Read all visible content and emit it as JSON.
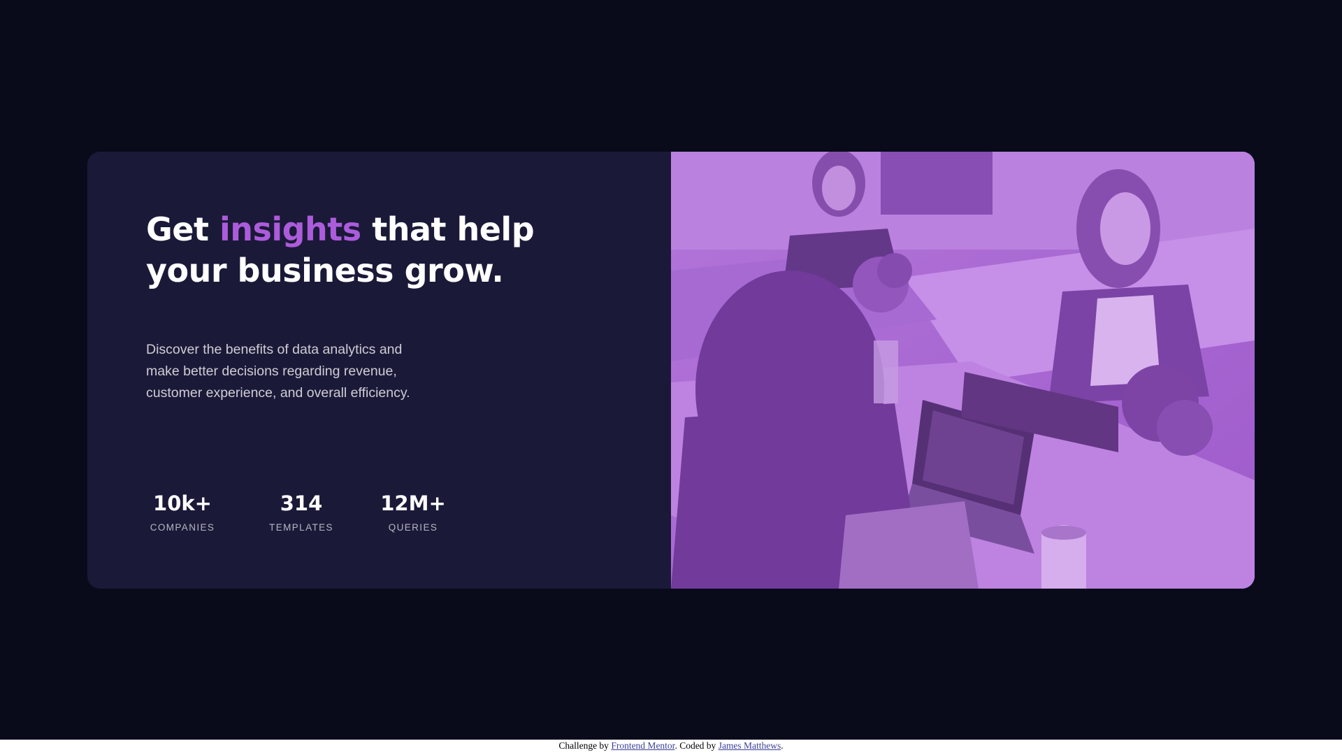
{
  "hero": {
    "title_part1": "Get ",
    "title_accent": "insights",
    "title_part2": " that help your business grow.",
    "description": "Discover the benefits of data analytics and make better decisions regarding revenue, customer experience, and overall efficiency."
  },
  "stats": [
    {
      "value": "10k+",
      "label": "COMPANIES"
    },
    {
      "value": "314",
      "label": "TEMPLATES"
    },
    {
      "value": "12M+",
      "label": "QUERIES"
    }
  ],
  "attribution": {
    "prefix": "Challenge by ",
    "link1": "Frontend Mentor",
    "middle": ". Coded by ",
    "link2": "James Matthews",
    "suffix": "."
  },
  "colors": {
    "page_bg": "#090b1b",
    "card_bg": "#1b1938",
    "accent": "#ab5cdb",
    "image_overlay": "#a766cf"
  },
  "image": {
    "icon": "office-team-photo"
  }
}
